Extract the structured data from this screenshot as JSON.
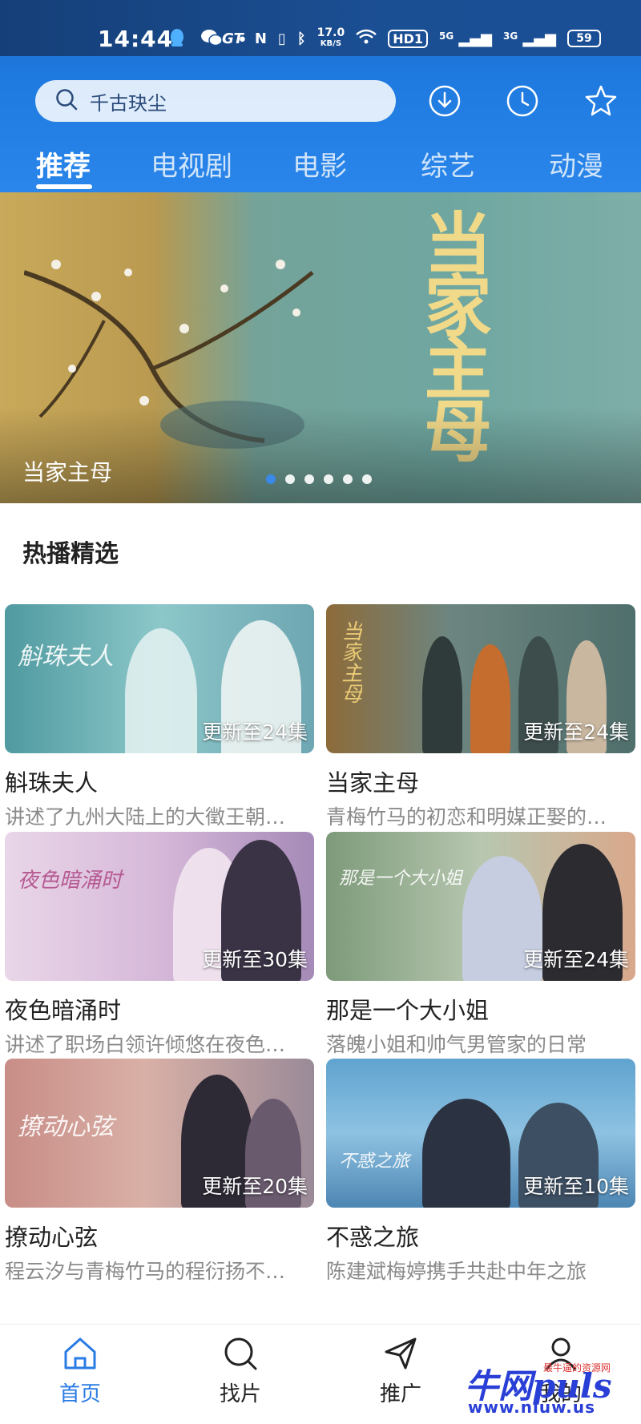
{
  "status_bar": {
    "time": "14:44",
    "net_speed_value": "17.0",
    "net_speed_unit": "KB/S",
    "hd_badge": "HD1",
    "signal_1": "5G",
    "signal_2": "3G",
    "battery": "59"
  },
  "search": {
    "placeholder_text": "千古玦尘"
  },
  "tabs": [
    {
      "label": "推荐",
      "active": true
    },
    {
      "label": "电视剧",
      "active": false
    },
    {
      "label": "电影",
      "active": false
    },
    {
      "label": "综艺",
      "active": false
    },
    {
      "label": "动漫",
      "active": false
    }
  ],
  "banner": {
    "caption": "当家主母",
    "art_title": "当家主母",
    "dot_count": 6,
    "active_dot": 0
  },
  "section": {
    "title": "热播精选"
  },
  "cards": [
    {
      "title": "斛珠夫人",
      "desc": "讲述了九州大陆上的大徵王朝…",
      "episode": "更新至24集",
      "art": "斛珠夫人"
    },
    {
      "title": "当家主母",
      "desc": "青梅竹马的初恋和明媒正娶的…",
      "episode": "更新至24集",
      "art": "当家主母"
    },
    {
      "title": "夜色暗涌时",
      "desc": "讲述了职场白领许倾悠在夜色…",
      "episode": "更新至30集",
      "art": "夜色暗涌时"
    },
    {
      "title": "那是一个大小姐",
      "desc": "落魄小姐和帅气男管家的日常",
      "episode": "更新至24集",
      "art": "那是一个大小姐"
    },
    {
      "title": "撩动心弦",
      "desc": "程云汐与青梅竹马的程衍扬不…",
      "episode": "更新至20集",
      "art": "撩动心弦"
    },
    {
      "title": "不惑之旅",
      "desc": "陈建斌梅婷携手共赴中年之旅",
      "episode": "更新至10集",
      "art": "不惑之旅"
    }
  ],
  "bottom_nav": [
    {
      "label": "首页",
      "icon": "home-icon",
      "active": true
    },
    {
      "label": "找片",
      "icon": "search-icon",
      "active": false
    },
    {
      "label": "推广",
      "icon": "send-icon",
      "active": false
    },
    {
      "label": "我的",
      "icon": "user-icon",
      "active": false
    }
  ],
  "watermark": {
    "main": "牛网puls",
    "sub": "最牛逼的资源网",
    "url": "www.niuw.us"
  },
  "colors": {
    "accent": "#2a7be4",
    "header_blue": "#1f7ae0"
  }
}
